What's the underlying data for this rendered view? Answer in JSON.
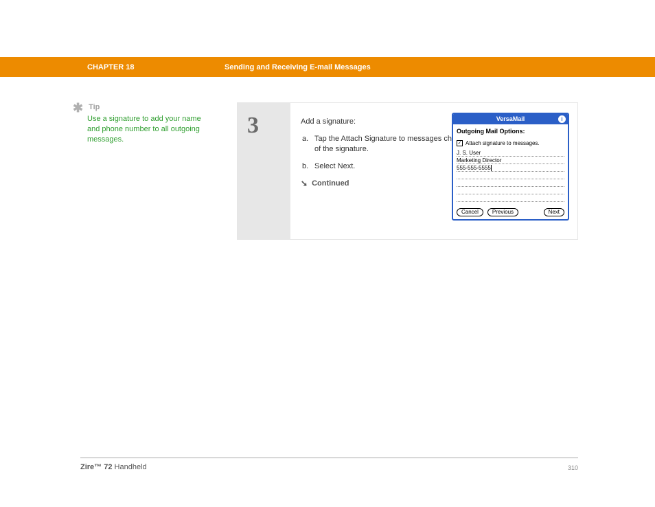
{
  "header": {
    "chapter": "CHAPTER 18",
    "topic": "Sending and Receiving E-mail Messages"
  },
  "tip": {
    "label": "Tip",
    "text": "Use a signature to add your name and phone number to all outgoing messages."
  },
  "step": {
    "number": "3",
    "title": "Add a signature:",
    "items": [
      {
        "letter": "a.",
        "text": "Tap the Attach Signature to messages check box, and then enter the text of the signature."
      },
      {
        "letter": "b.",
        "text": "Select Next."
      }
    ],
    "continued": "Continued"
  },
  "device": {
    "title": "VersaMail",
    "info": "i",
    "heading": "Outgoing Mail Options:",
    "check_label": "Attach signature to messages.",
    "check_mark": "✓",
    "sig_lines": [
      "J. S. User",
      "Marketing Director",
      "555-555-5555",
      "",
      "",
      "",
      ""
    ],
    "buttons": {
      "cancel": "Cancel",
      "previous": "Previous",
      "next": "Next"
    }
  },
  "footer": {
    "product_bold": "Zire™ 72",
    "product_rest": " Handheld",
    "page": "310"
  }
}
